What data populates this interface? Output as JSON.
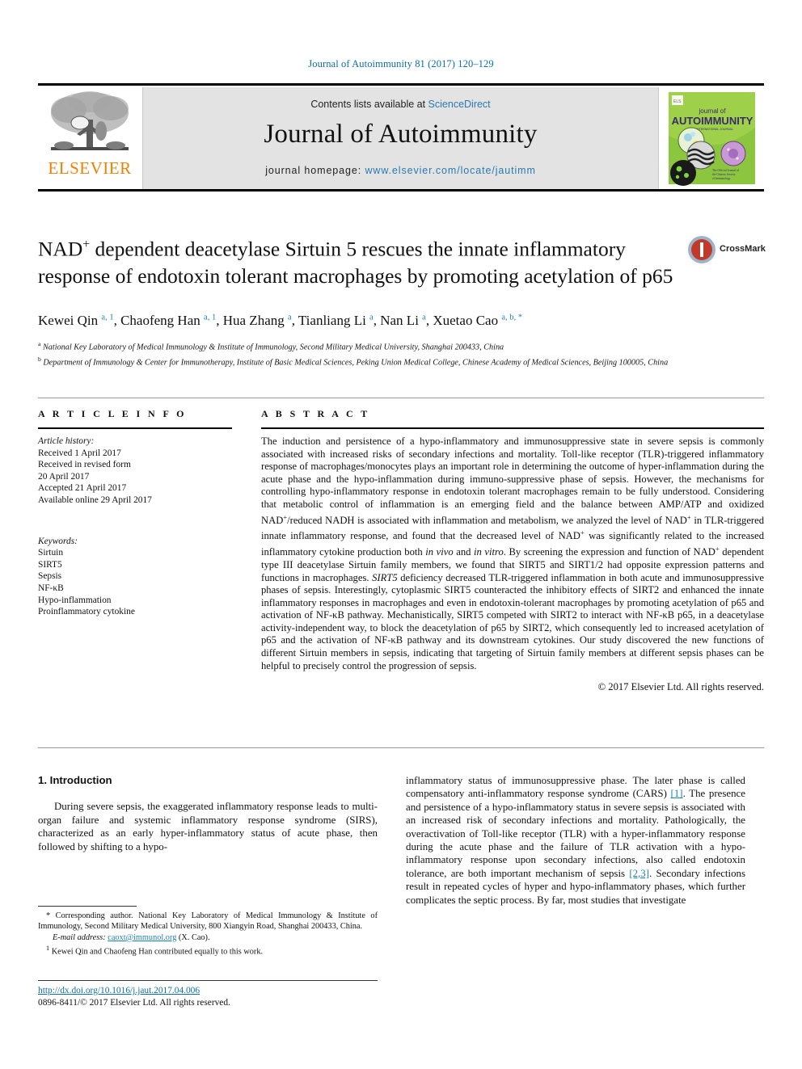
{
  "running_head": "Journal of Autoimmunity 81 (2017) 120–129",
  "masthead": {
    "contents_prefix": "Contents lists available at ",
    "contents_link": "ScienceDirect",
    "journal_name": "Journal of Autoimmunity",
    "homepage_prefix": "journal homepage: ",
    "homepage_link": "www.elsevier.com/locate/jautimm",
    "publisher_wordmark": "ELSEVIER",
    "cover": {
      "line1": "journal of",
      "line2": "AUTOIMMUNITY",
      "tagline": "AN INTERNATIONAL JOURNAL"
    },
    "colors": {
      "link": "#2a7ab0",
      "band": "#e3e3e3",
      "elsevier_orange": "#f08000",
      "cover_green": "#8cc63f"
    }
  },
  "article": {
    "title_part1": "NAD",
    "title_sup": "+",
    "title_part2": " dependent deacetylase Sirtuin 5 rescues the innate inflammatory response of endotoxin tolerant macrophages by promoting acetylation of p65",
    "crossmark_label": "CrossMark",
    "authors": [
      {
        "name": "Kewei Qin",
        "marks": "a, 1"
      },
      {
        "name": "Chaofeng Han",
        "marks": "a, 1"
      },
      {
        "name": "Hua Zhang",
        "marks": "a"
      },
      {
        "name": "Tianliang Li",
        "marks": "a"
      },
      {
        "name": "Nan Li",
        "marks": "a"
      },
      {
        "name": "Xuetao Cao",
        "marks": "a, b, *"
      }
    ],
    "affiliations": [
      {
        "mark": "a",
        "text": "National Key Laboratory of Medical Immunology & Institute of Immunology, Second Military Medical University, Shanghai 200433, China"
      },
      {
        "mark": "b",
        "text": "Department of Immunology & Center for Immunotherapy, Institute of Basic Medical Sciences, Peking Union Medical College, Chinese Academy of Medical Sciences, Beijing 100005, China"
      }
    ]
  },
  "article_info": {
    "heading": "A R T I C L E  I N F O",
    "history_label": "Article history:",
    "history": [
      "Received 1 April 2017",
      "Received in revised form",
      "20 April 2017",
      "Accepted 21 April 2017",
      "Available online 29 April 2017"
    ],
    "keywords_label": "Keywords:",
    "keywords": [
      "Sirtuin",
      "SIRT5",
      "Sepsis",
      "NF-κB",
      "Hypo-inflammation",
      "Proinflammatory cytokine"
    ]
  },
  "abstract": {
    "heading": "A B S T R A C T",
    "p1": "The induction and persistence of a hypo-inflammatory and immunosuppressive state in severe sepsis is commonly associated with increased risks of secondary infections and mortality. Toll-like receptor (TLR)-triggered inflammatory response of macrophages/monocytes plays an important role in determining the outcome of hyper-inflammation during the acute phase and the hypo-inflammation during immuno-suppressive phase of sepsis. However, the mechanisms for controlling hypo-inflammatory response in endotoxin tolerant macrophages remain to be fully understood. Considering that metabolic control of inflammation is an emerging field and the balance between AMP/ATP and oxidized NAD",
    "p1b": "/reduced NADH is associated with inflammation and metabolism, we analyzed the level of NAD",
    "p1c": " in TLR-triggered innate inflammatory response, and found that the decreased level of NAD",
    "p1d": " was significantly related to the increased inflammatory cytokine production both ",
    "invivo": "in vivo",
    "and": " and ",
    "invitro": "in vitro",
    "p1e": ". By screening the expression and function of NAD",
    "p1f": " dependent type III deacetylase Sirtuin family members, we found that SIRT5 and SIRT1/2 had opposite expression patterns and functions in macrophages. ",
    "sirt5_italic": "SIRT5",
    "p1g": " deficiency decreased TLR-triggered inflammation in both acute and immunosuppressive phases of sepsis. Interestingly, cytoplasmic SIRT5 counteracted the inhibitory effects of SIRT2 and enhanced the innate inflammatory responses in macrophages and even in endotoxin-tolerant macrophages by promoting acetylation of p65 and activation of NF-κB pathway. Mechanistically, SIRT5 competed with SIRT2 to interact with NF-κB p65, in a deacetylase activity-independent way, to block the deacetylation of p65 by SIRT2, which consequently led to increased acetylation of p65 and the activation of NF-κB pathway and its downstream cytokines. Our study discovered the new functions of different Sirtuin members in sepsis, indicating that targeting of Sirtuin family members at different sepsis phases can be helpful to precisely control the progression of sepsis.",
    "copyright": "© 2017 Elsevier Ltd. All rights reserved."
  },
  "introduction": {
    "heading": "1. Introduction",
    "left_p1": "During severe sepsis, the exaggerated inflammatory response leads to multi-organ failure and systemic inflammatory response syndrome (SIRS), characterized as an early hyper-inflammatory status of acute phase, then followed by shifting to a hypo-",
    "right_a": "inflammatory status of immunosuppressive phase. The later phase is called compensatory anti-inflammatory response syndrome (CARS) ",
    "ref1": "[1]",
    "right_b": ". The presence and persistence of a hypo-inflammatory status in severe sepsis is associated with an increased risk of secondary infections and mortality. Pathologically, the overactivation of Toll-like receptor (TLR) with a hyper-inflammatory response during the acute phase and the failure of TLR activation with a hypo-inflammatory response upon secondary infections, also called endotoxin tolerance, are both important mechanism of sepsis ",
    "ref23": "[2,3]",
    "right_c": ". Secondary infections result in repeated cycles of hyper and hypo-inflammatory phases, which further complicates the septic process. By far, most studies that investigate"
  },
  "footnotes": {
    "corresponding_star": "*",
    "corresponding": " Corresponding author. National Key Laboratory of Medical Immunology & Institute of Immunology, Second Military Medical University, 800 Xiangyin Road, Shanghai 200433, China.",
    "email_label": "E-mail address: ",
    "email_address": "caoxt@immunol.org",
    "email_suffix": " (X. Cao).",
    "equal_mark": "1",
    "equal_contrib": " Kewei Qin and Chaofeng Han contributed equally to this work."
  },
  "bottom": {
    "doi": "http://dx.doi.org/10.1016/j.jaut.2017.04.006",
    "issn_line": "0896-8411/© 2017 Elsevier Ltd. All rights reserved."
  }
}
